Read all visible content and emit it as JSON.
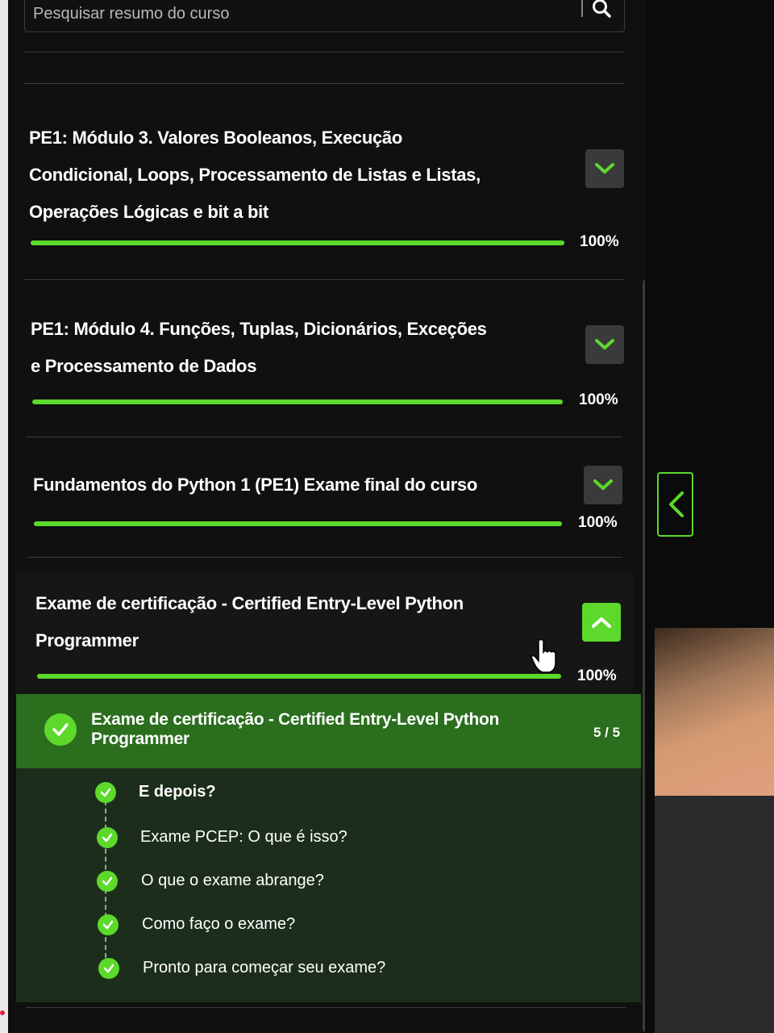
{
  "search": {
    "placeholder": "Pesquisar resumo do curso",
    "icon": "search-icon"
  },
  "modules": [
    {
      "title_lines": [
        "PE1: Módulo 3. Valores Booleanos, Execução",
        "Condicional, Loops, Processamento de Listas e Listas,",
        "Operações Lógicas e bit a bit"
      ],
      "progress_pct": 100,
      "progress_label": "100%",
      "expanded": false
    },
    {
      "title_lines": [
        "PE1: Módulo 4. Funções, Tuplas, Dicionários, Exceções",
        "e Processamento de Dados"
      ],
      "progress_pct": 100,
      "progress_label": "100%",
      "expanded": false
    },
    {
      "title_lines": [
        "Fundamentos do Python 1 (PE1) Exame final do curso"
      ],
      "progress_pct": 100,
      "progress_label": "100%",
      "expanded": false
    },
    {
      "title_lines": [
        "Exame de certificação - Certified Entry-Level Python",
        "Programmer"
      ],
      "progress_pct": 100,
      "progress_label": "100%",
      "expanded": true
    }
  ],
  "submodule": {
    "title_lines": [
      "Exame de certificação - Certified Entry-Level Python",
      "Programmer"
    ],
    "count": "5 / 5",
    "lessons": [
      {
        "label": "E depois?"
      },
      {
        "label": "Exame PCEP: O que é isso?"
      },
      {
        "label": "O que o exame abrange?"
      },
      {
        "label": "Como faço o exame?"
      },
      {
        "label": "Pronto para começar seu exame?"
      }
    ]
  },
  "colors": {
    "accent": "#5cd92b",
    "panel_bg": "#101010",
    "submodule_bg": "#2a6e1e",
    "lessons_bg": "#1c2e1b"
  }
}
